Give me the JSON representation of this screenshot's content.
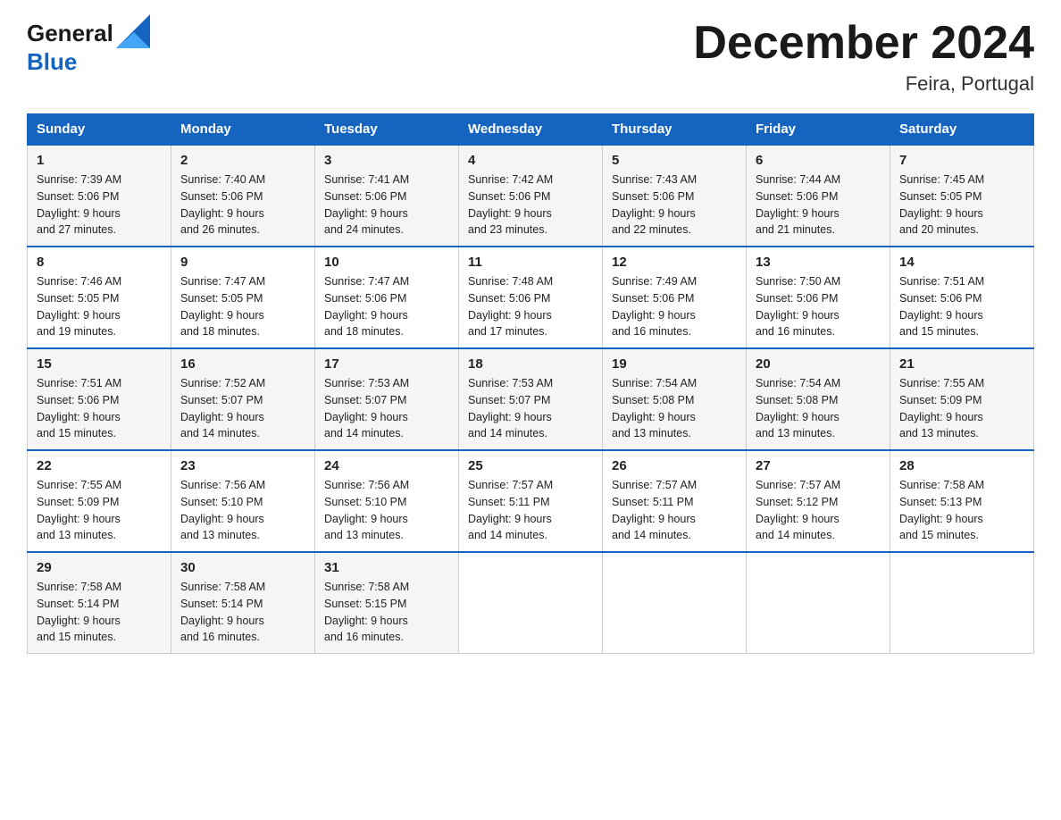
{
  "header": {
    "logo_line1": "General",
    "logo_line2": "Blue",
    "title": "December 2024",
    "location": "Feira, Portugal"
  },
  "days_of_week": [
    "Sunday",
    "Monday",
    "Tuesday",
    "Wednesday",
    "Thursday",
    "Friday",
    "Saturday"
  ],
  "weeks": [
    [
      {
        "day": "1",
        "sunrise": "Sunrise: 7:39 AM",
        "sunset": "Sunset: 5:06 PM",
        "daylight": "Daylight: 9 hours",
        "daylight2": "and 27 minutes."
      },
      {
        "day": "2",
        "sunrise": "Sunrise: 7:40 AM",
        "sunset": "Sunset: 5:06 PM",
        "daylight": "Daylight: 9 hours",
        "daylight2": "and 26 minutes."
      },
      {
        "day": "3",
        "sunrise": "Sunrise: 7:41 AM",
        "sunset": "Sunset: 5:06 PM",
        "daylight": "Daylight: 9 hours",
        "daylight2": "and 24 minutes."
      },
      {
        "day": "4",
        "sunrise": "Sunrise: 7:42 AM",
        "sunset": "Sunset: 5:06 PM",
        "daylight": "Daylight: 9 hours",
        "daylight2": "and 23 minutes."
      },
      {
        "day": "5",
        "sunrise": "Sunrise: 7:43 AM",
        "sunset": "Sunset: 5:06 PM",
        "daylight": "Daylight: 9 hours",
        "daylight2": "and 22 minutes."
      },
      {
        "day": "6",
        "sunrise": "Sunrise: 7:44 AM",
        "sunset": "Sunset: 5:06 PM",
        "daylight": "Daylight: 9 hours",
        "daylight2": "and 21 minutes."
      },
      {
        "day": "7",
        "sunrise": "Sunrise: 7:45 AM",
        "sunset": "Sunset: 5:05 PM",
        "daylight": "Daylight: 9 hours",
        "daylight2": "and 20 minutes."
      }
    ],
    [
      {
        "day": "8",
        "sunrise": "Sunrise: 7:46 AM",
        "sunset": "Sunset: 5:05 PM",
        "daylight": "Daylight: 9 hours",
        "daylight2": "and 19 minutes."
      },
      {
        "day": "9",
        "sunrise": "Sunrise: 7:47 AM",
        "sunset": "Sunset: 5:05 PM",
        "daylight": "Daylight: 9 hours",
        "daylight2": "and 18 minutes."
      },
      {
        "day": "10",
        "sunrise": "Sunrise: 7:47 AM",
        "sunset": "Sunset: 5:06 PM",
        "daylight": "Daylight: 9 hours",
        "daylight2": "and 18 minutes."
      },
      {
        "day": "11",
        "sunrise": "Sunrise: 7:48 AM",
        "sunset": "Sunset: 5:06 PM",
        "daylight": "Daylight: 9 hours",
        "daylight2": "and 17 minutes."
      },
      {
        "day": "12",
        "sunrise": "Sunrise: 7:49 AM",
        "sunset": "Sunset: 5:06 PM",
        "daylight": "Daylight: 9 hours",
        "daylight2": "and 16 minutes."
      },
      {
        "day": "13",
        "sunrise": "Sunrise: 7:50 AM",
        "sunset": "Sunset: 5:06 PM",
        "daylight": "Daylight: 9 hours",
        "daylight2": "and 16 minutes."
      },
      {
        "day": "14",
        "sunrise": "Sunrise: 7:51 AM",
        "sunset": "Sunset: 5:06 PM",
        "daylight": "Daylight: 9 hours",
        "daylight2": "and 15 minutes."
      }
    ],
    [
      {
        "day": "15",
        "sunrise": "Sunrise: 7:51 AM",
        "sunset": "Sunset: 5:06 PM",
        "daylight": "Daylight: 9 hours",
        "daylight2": "and 15 minutes."
      },
      {
        "day": "16",
        "sunrise": "Sunrise: 7:52 AM",
        "sunset": "Sunset: 5:07 PM",
        "daylight": "Daylight: 9 hours",
        "daylight2": "and 14 minutes."
      },
      {
        "day": "17",
        "sunrise": "Sunrise: 7:53 AM",
        "sunset": "Sunset: 5:07 PM",
        "daylight": "Daylight: 9 hours",
        "daylight2": "and 14 minutes."
      },
      {
        "day": "18",
        "sunrise": "Sunrise: 7:53 AM",
        "sunset": "Sunset: 5:07 PM",
        "daylight": "Daylight: 9 hours",
        "daylight2": "and 14 minutes."
      },
      {
        "day": "19",
        "sunrise": "Sunrise: 7:54 AM",
        "sunset": "Sunset: 5:08 PM",
        "daylight": "Daylight: 9 hours",
        "daylight2": "and 13 minutes."
      },
      {
        "day": "20",
        "sunrise": "Sunrise: 7:54 AM",
        "sunset": "Sunset: 5:08 PM",
        "daylight": "Daylight: 9 hours",
        "daylight2": "and 13 minutes."
      },
      {
        "day": "21",
        "sunrise": "Sunrise: 7:55 AM",
        "sunset": "Sunset: 5:09 PM",
        "daylight": "Daylight: 9 hours",
        "daylight2": "and 13 minutes."
      }
    ],
    [
      {
        "day": "22",
        "sunrise": "Sunrise: 7:55 AM",
        "sunset": "Sunset: 5:09 PM",
        "daylight": "Daylight: 9 hours",
        "daylight2": "and 13 minutes."
      },
      {
        "day": "23",
        "sunrise": "Sunrise: 7:56 AM",
        "sunset": "Sunset: 5:10 PM",
        "daylight": "Daylight: 9 hours",
        "daylight2": "and 13 minutes."
      },
      {
        "day": "24",
        "sunrise": "Sunrise: 7:56 AM",
        "sunset": "Sunset: 5:10 PM",
        "daylight": "Daylight: 9 hours",
        "daylight2": "and 13 minutes."
      },
      {
        "day": "25",
        "sunrise": "Sunrise: 7:57 AM",
        "sunset": "Sunset: 5:11 PM",
        "daylight": "Daylight: 9 hours",
        "daylight2": "and 14 minutes."
      },
      {
        "day": "26",
        "sunrise": "Sunrise: 7:57 AM",
        "sunset": "Sunset: 5:11 PM",
        "daylight": "Daylight: 9 hours",
        "daylight2": "and 14 minutes."
      },
      {
        "day": "27",
        "sunrise": "Sunrise: 7:57 AM",
        "sunset": "Sunset: 5:12 PM",
        "daylight": "Daylight: 9 hours",
        "daylight2": "and 14 minutes."
      },
      {
        "day": "28",
        "sunrise": "Sunrise: 7:58 AM",
        "sunset": "Sunset: 5:13 PM",
        "daylight": "Daylight: 9 hours",
        "daylight2": "and 15 minutes."
      }
    ],
    [
      {
        "day": "29",
        "sunrise": "Sunrise: 7:58 AM",
        "sunset": "Sunset: 5:14 PM",
        "daylight": "Daylight: 9 hours",
        "daylight2": "and 15 minutes."
      },
      {
        "day": "30",
        "sunrise": "Sunrise: 7:58 AM",
        "sunset": "Sunset: 5:14 PM",
        "daylight": "Daylight: 9 hours",
        "daylight2": "and 16 minutes."
      },
      {
        "day": "31",
        "sunrise": "Sunrise: 7:58 AM",
        "sunset": "Sunset: 5:15 PM",
        "daylight": "Daylight: 9 hours",
        "daylight2": "and 16 minutes."
      },
      {
        "day": "",
        "sunrise": "",
        "sunset": "",
        "daylight": "",
        "daylight2": ""
      },
      {
        "day": "",
        "sunrise": "",
        "sunset": "",
        "daylight": "",
        "daylight2": ""
      },
      {
        "day": "",
        "sunrise": "",
        "sunset": "",
        "daylight": "",
        "daylight2": ""
      },
      {
        "day": "",
        "sunrise": "",
        "sunset": "",
        "daylight": "",
        "daylight2": ""
      }
    ]
  ]
}
